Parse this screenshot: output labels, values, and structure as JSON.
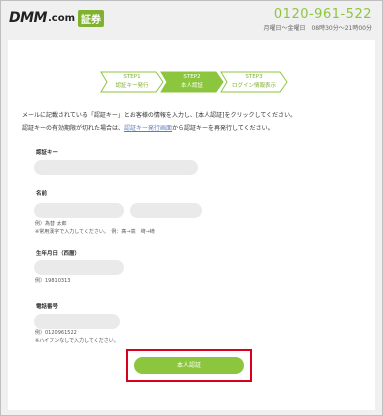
{
  "header": {
    "logo_dmm": "DMM",
    "logo_com": ".com",
    "logo_badge": "証券",
    "phone": "0120-961-522",
    "hours": "月曜日～金曜日　08時30分～21時00分"
  },
  "steps": [
    {
      "num": "STEP1",
      "label": "認証キー発行"
    },
    {
      "num": "STEP2",
      "label": "本人認証"
    },
    {
      "num": "STEP3",
      "label": "ログイン情報表示"
    }
  ],
  "intro": {
    "line1": "メールに記載されている「認証キー」とお客様の情報を入力し、[本人認証]をクリックしてください。",
    "line2_before": "認証キーの有効期限が切れた場合は、",
    "line2_link": "認証キー発行画面",
    "line2_after": "から認証キーを再発行してください。"
  },
  "fields": {
    "auth_key_label": "認証キー",
    "name_label": "名前",
    "name_hint1": "例）為替 太郎",
    "name_hint2": "※常用漢字で入力してください。　例：髙→高　﨑→崎",
    "birth_label": "生年月日（西暦）",
    "birth_hint": "例）19810313",
    "phone_label": "電話番号",
    "phone_hint1": "例）0120961522",
    "phone_hint2": "※ハイフンなしで入力してください。"
  },
  "submit_label": "本人認証",
  "colors": {
    "accent": "#8cc63f",
    "highlight": "#d8001c"
  }
}
